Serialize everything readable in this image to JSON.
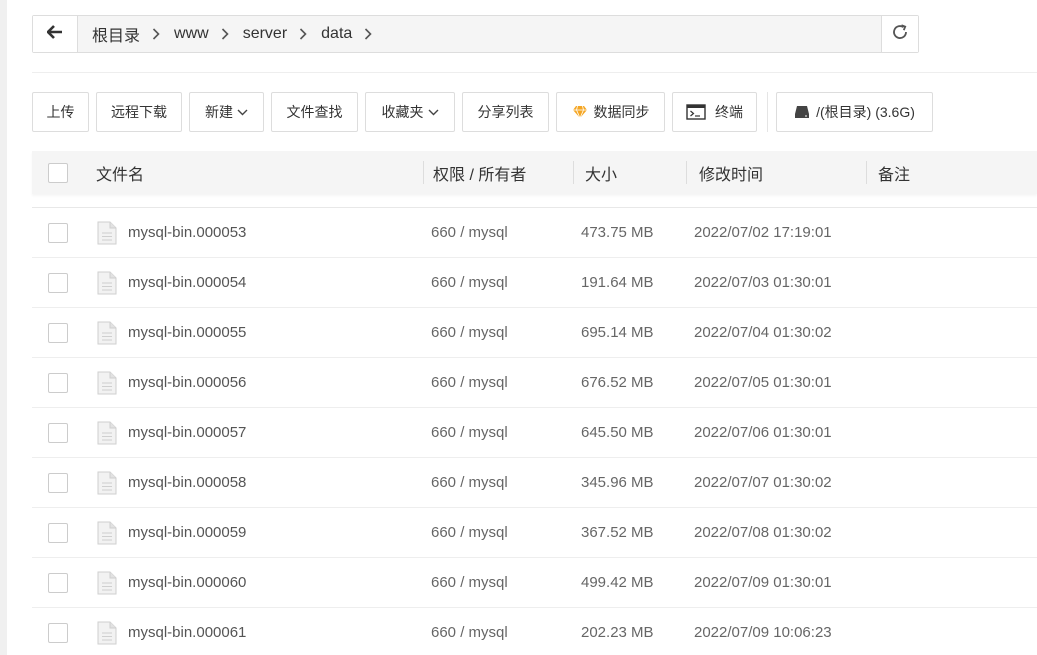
{
  "pathbar": {
    "crumbs": [
      {
        "label": "根目录"
      },
      {
        "label": "www"
      },
      {
        "label": "server"
      },
      {
        "label": "data"
      }
    ]
  },
  "toolbar": {
    "upload": "上传",
    "remote_download": "远程下载",
    "new": "新建",
    "file_search": "文件查找",
    "favorites": "收藏夹",
    "share_list": "分享列表",
    "data_sync": "数据同步",
    "terminal": "终端",
    "disk": "/(根目录) (3.6G)"
  },
  "table": {
    "headers": {
      "name": "文件名",
      "perm": "权限 / 所有者",
      "size": "大小",
      "mtime": "修改时间",
      "note": "备注"
    },
    "rows": [
      {
        "name": "mysql-bin.000053",
        "perm": "660 / mysql",
        "size": "473.75 MB",
        "mtime": "2022/07/02 17:19:01"
      },
      {
        "name": "mysql-bin.000054",
        "perm": "660 / mysql",
        "size": "191.64 MB",
        "mtime": "2022/07/03 01:30:01"
      },
      {
        "name": "mysql-bin.000055",
        "perm": "660 / mysql",
        "size": "695.14 MB",
        "mtime": "2022/07/04 01:30:02"
      },
      {
        "name": "mysql-bin.000056",
        "perm": "660 / mysql",
        "size": "676.52 MB",
        "mtime": "2022/07/05 01:30:01"
      },
      {
        "name": "mysql-bin.000057",
        "perm": "660 / mysql",
        "size": "645.50 MB",
        "mtime": "2022/07/06 01:30:01"
      },
      {
        "name": "mysql-bin.000058",
        "perm": "660 / mysql",
        "size": "345.96 MB",
        "mtime": "2022/07/07 01:30:02"
      },
      {
        "name": "mysql-bin.000059",
        "perm": "660 / mysql",
        "size": "367.52 MB",
        "mtime": "2022/07/08 01:30:02"
      },
      {
        "name": "mysql-bin.000060",
        "perm": "660 / mysql",
        "size": "499.42 MB",
        "mtime": "2022/07/09 01:30:01"
      },
      {
        "name": "mysql-bin.000061",
        "perm": "660 / mysql",
        "size": "202.23 MB",
        "mtime": "2022/07/09 10:06:23"
      }
    ]
  },
  "icons": {
    "back": "arrow-left-icon",
    "separator": "chevron-right-icon",
    "refresh": "refresh-icon",
    "caret": "chevron-down-icon",
    "data_sync": "diamond-icon",
    "terminal": "terminal-icon",
    "disk": "hard-drive-icon",
    "file": "file-icon"
  },
  "colors": {
    "diamond": "#f5a623",
    "border": "#dddddd",
    "header_bg": "#f5f5f5"
  }
}
